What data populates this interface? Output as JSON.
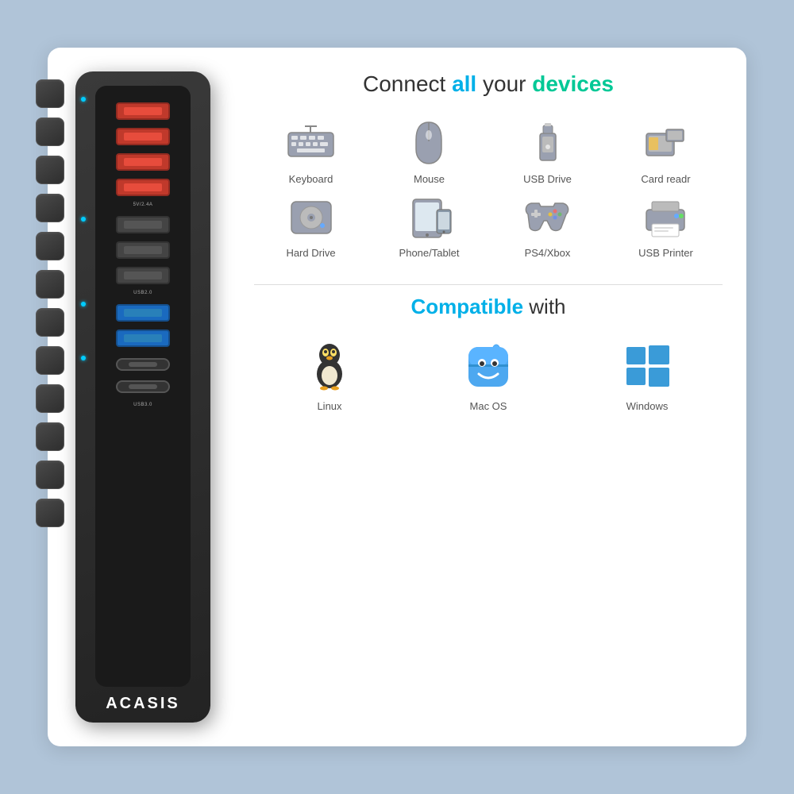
{
  "page": {
    "background": "#b0c4d8"
  },
  "header": {
    "connect_prefix": "Connect ",
    "connect_all": "all",
    "connect_middle": " your ",
    "connect_devices": "devices"
  },
  "devices": [
    {
      "name": "Keyboard",
      "icon": "keyboard"
    },
    {
      "name": "Mouse",
      "icon": "mouse"
    },
    {
      "name": "USB Drive",
      "icon": "usb-drive"
    },
    {
      "name": "Card readr",
      "icon": "card-reader"
    },
    {
      "name": "Hard Drive",
      "icon": "hard-drive"
    },
    {
      "name": "Phone/Tablet",
      "icon": "phone-tablet"
    },
    {
      "name": "PS4/Xbox",
      "icon": "gamepad"
    },
    {
      "name": "USB Printer",
      "icon": "printer"
    }
  ],
  "compatible": {
    "title_prefix": "Compatible ",
    "title_with": "with",
    "items": [
      {
        "name": "Linux",
        "icon": "linux"
      },
      {
        "name": "Mac OS",
        "icon": "macos"
      },
      {
        "name": "Windows",
        "icon": "windows"
      }
    ]
  },
  "brand": "ACASIS",
  "ports": {
    "usb_a_red_count": 4,
    "usb_a_black_count": 3,
    "usb_a_blue_count": 2,
    "usb_c_count": 2,
    "labels": [
      "5V/2.4A",
      "USB2.0",
      "USB3.0"
    ]
  }
}
